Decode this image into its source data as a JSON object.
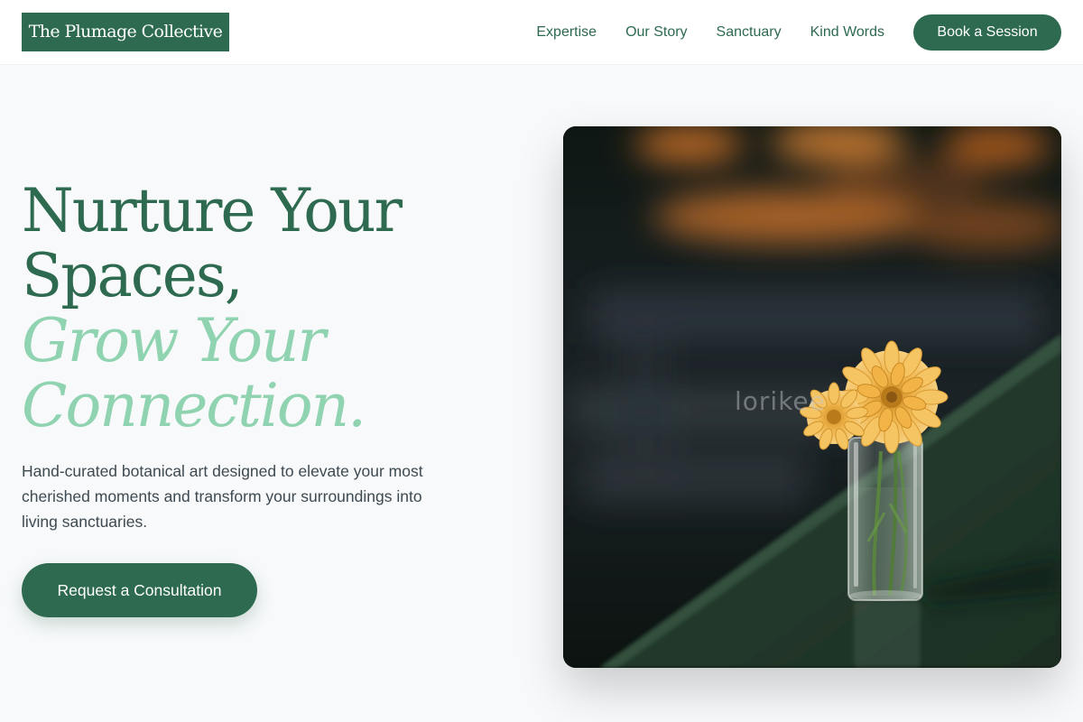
{
  "brand": {
    "name": "The Plumage Collective"
  },
  "nav": {
    "items": [
      {
        "label": "Expertise"
      },
      {
        "label": "Our Story"
      },
      {
        "label": "Sanctuary"
      },
      {
        "label": "Kind Words"
      }
    ],
    "cta_label": "Book a Session"
  },
  "hero": {
    "headline_line1": "Nurture Your",
    "headline_line2": "Spaces,",
    "headline_line3": "Grow Your",
    "headline_line4": "Connection.",
    "description": "Hand-curated botanical art designed to elevate your most cherished moments and transform your surroundings into living sanctuaries.",
    "cta_label": "Request a Consultation",
    "image_watermark": "lorikee"
  },
  "colors": {
    "primary": "#2d6a4f",
    "accent": "#8fd3b0",
    "background": "#f7f9fa",
    "body_text": "#3e4a52"
  }
}
